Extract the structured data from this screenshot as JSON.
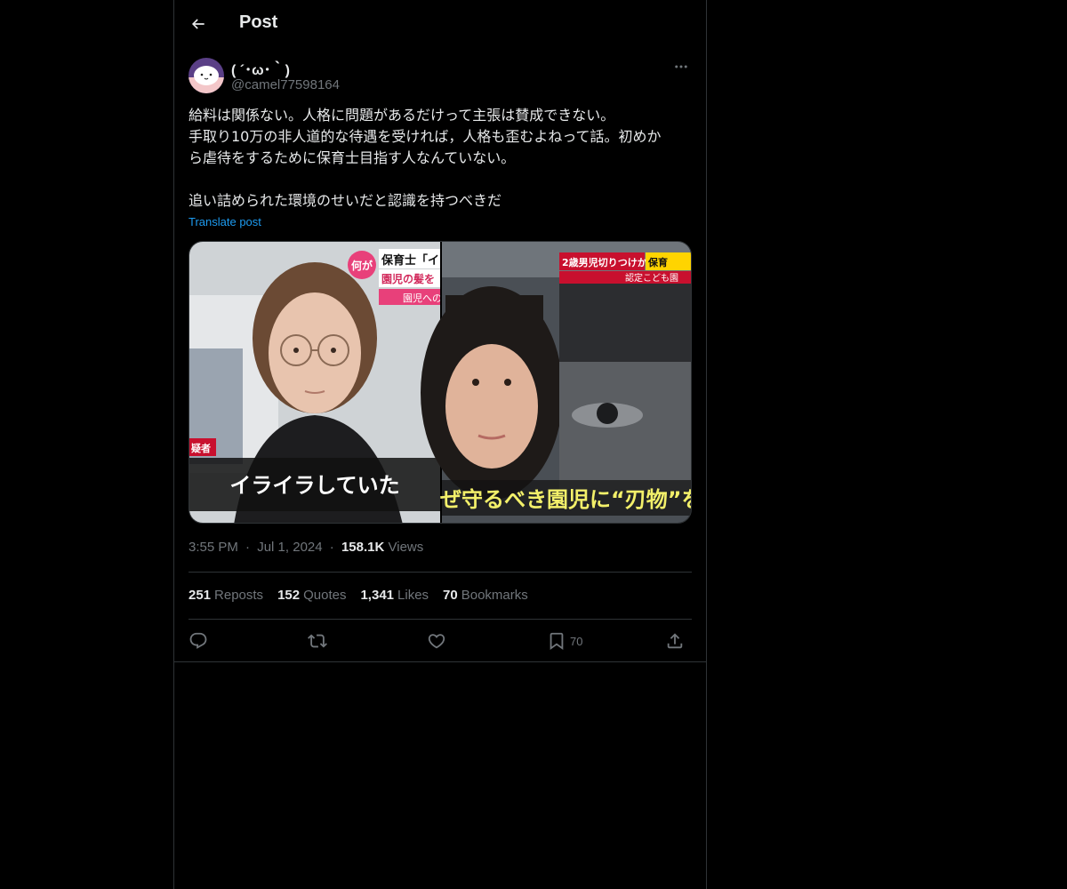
{
  "header": {
    "title": "Post"
  },
  "author": {
    "display_name": "( ´･ω･｀)",
    "handle": "@camel77598164"
  },
  "post": {
    "lines": [
      "給料は関係ない。人格に問題があるだけって主張は賛成できない。",
      "手取り10万の非人道的な待遇を受ければ，人格も歪むよねって話。初めか",
      "ら虐待をするために保育士目指す人なんていない。",
      "",
      "追い詰められた環境のせいだと認識を持つべきだ"
    ],
    "translate_label": "Translate post"
  },
  "media": {
    "left_image": {
      "top_badge": "何が",
      "top_caption": "保育士「イ",
      "sub_caption": "園児の髪を",
      "sub_caption2": "園児への",
      "side_tag": "疑者",
      "bottom_caption": "イライラしていた"
    },
    "right_image": {
      "top_caption": "2歳男児切りつけか",
      "top_caption_tag": "保育",
      "sub_caption": "認定こども園",
      "bottom_caption": "ぜ守るべき園児に“刃物”を"
    }
  },
  "meta": {
    "time": "3:55 PM",
    "separator": "·",
    "date": "Jul 1, 2024",
    "views_count": "158.1K",
    "views_label": "Views"
  },
  "stats": [
    {
      "count": "251",
      "label": "Reposts"
    },
    {
      "count": "152",
      "label": "Quotes"
    },
    {
      "count": "1,341",
      "label": "Likes"
    },
    {
      "count": "70",
      "label": "Bookmarks"
    }
  ],
  "actions": {
    "bookmark_count": "70"
  },
  "colors": {
    "background": "#000000",
    "text": "#e7e9ea",
    "muted": "#71767b",
    "border": "#2f3336",
    "accent": "#1d9bf0"
  },
  "icons": {
    "back": "arrow-left-icon",
    "more": "more-horizontal-icon",
    "reply": "reply-icon",
    "repost": "repost-icon",
    "like": "heart-icon",
    "bookmark": "bookmark-icon",
    "share": "share-icon"
  }
}
